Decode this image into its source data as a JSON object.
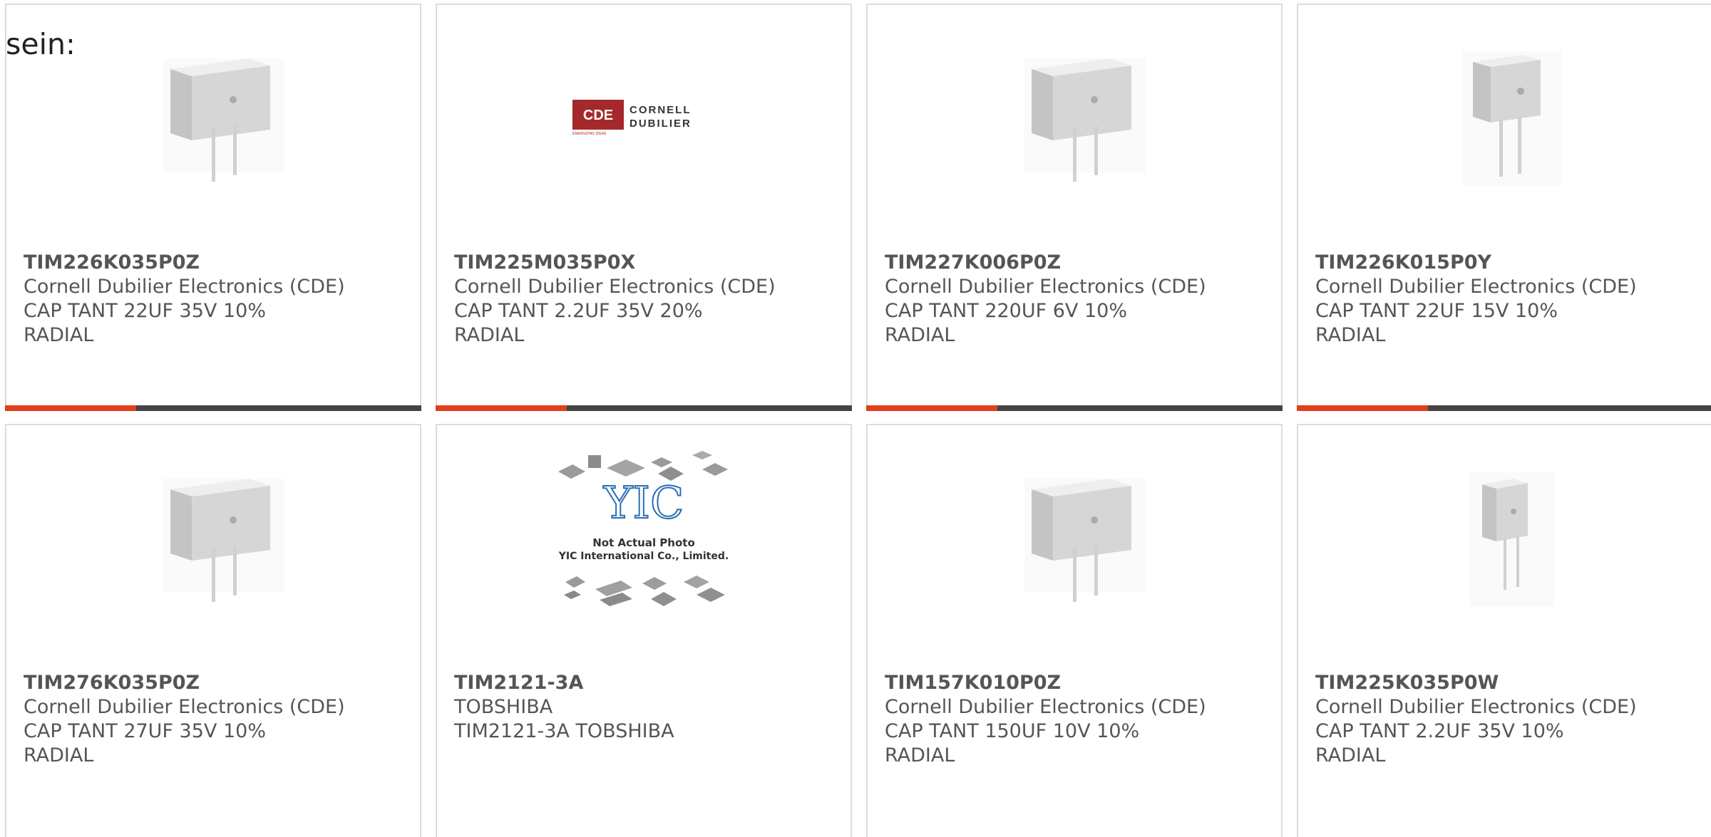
{
  "intro": "sein:",
  "accent_color": "#e0401a",
  "cards": [
    {
      "part": "TIM226K035P0Z",
      "maker": "Cornell Dubilier Electronics (CDE)",
      "desc": "CAP TANT 22UF 35V 10%",
      "pkg": "RADIAL",
      "image": "capacitor-wide"
    },
    {
      "part": "TIM225M035P0X",
      "maker": "Cornell Dubilier Electronics (CDE)",
      "desc": "CAP TANT 2.2UF 35V 20%",
      "pkg": "RADIAL",
      "image": "cde-logo"
    },
    {
      "part": "TIM227K006P0Z",
      "maker": "Cornell Dubilier Electronics (CDE)",
      "desc": "CAP TANT 220UF 6V 10%",
      "pkg": "RADIAL",
      "image": "capacitor-wide"
    },
    {
      "part": "TIM226K015P0Y",
      "maker": "Cornell Dubilier Electronics (CDE)",
      "desc": "CAP TANT 22UF 15V 10%",
      "pkg": "RADIAL",
      "image": "capacitor-narrow"
    },
    {
      "part": "TIM276K035P0Z",
      "maker": "Cornell Dubilier Electronics (CDE)",
      "desc": "CAP TANT 27UF 35V 10%",
      "pkg": "RADIAL",
      "image": "capacitor-wide"
    },
    {
      "part": "TIM2121-3A",
      "maker": "TOBSHIBA",
      "desc": "TIM2121-3A TOBSHIBA",
      "pkg": "",
      "image": "yic-placeholder"
    },
    {
      "part": "TIM157K010P0Z",
      "maker": "Cornell Dubilier Electronics (CDE)",
      "desc": "CAP TANT 150UF 10V 10%",
      "pkg": "RADIAL",
      "image": "capacitor-wide"
    },
    {
      "part": "TIM225K035P0W",
      "maker": "Cornell Dubilier Electronics (CDE)",
      "desc": "CAP TANT 2.2UF 35V 10%",
      "pkg": "RADIAL",
      "image": "capacitor-small"
    }
  ],
  "logo_cde": {
    "mark": "CDE",
    "line1": "CORNELL",
    "line2": "DUBILIER",
    "tagline": "ENERGIZING IDEAS"
  },
  "logo_yic": {
    "mark": "YIC",
    "line1": "Not Actual Photo",
    "line2": "YIC International Co., Limited."
  }
}
